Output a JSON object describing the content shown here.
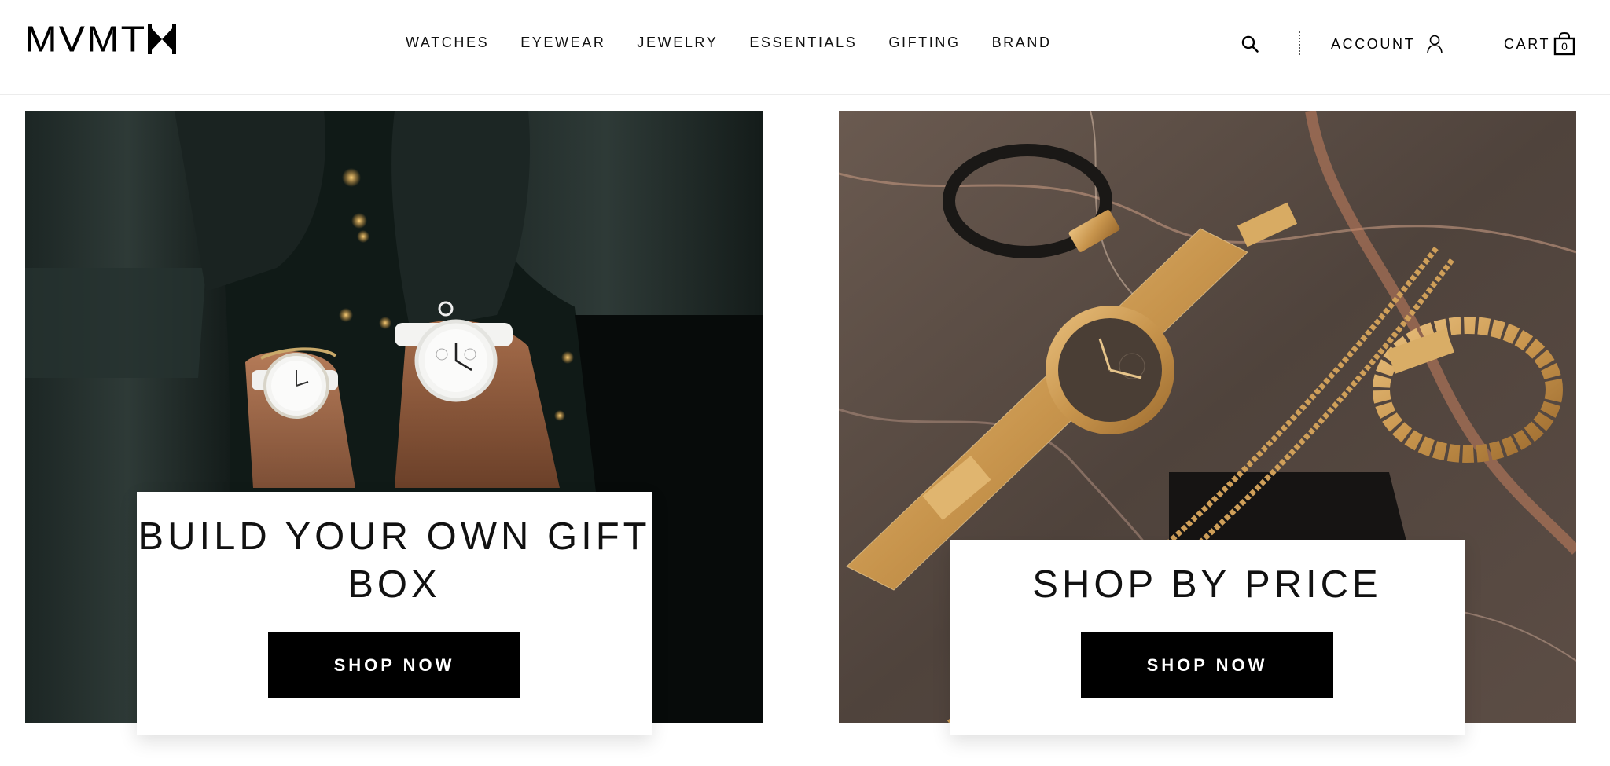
{
  "brand": {
    "logo_text": "MVMT"
  },
  "nav": {
    "items": [
      "WATCHES",
      "EYEWEAR",
      "JEWELRY",
      "ESSENTIALS",
      "GIFTING",
      "BRAND"
    ]
  },
  "utility": {
    "account_label": "ACCOUNT",
    "cart_label": "CART",
    "cart_count": "0"
  },
  "tiles": [
    {
      "title": "BUILD YOUR OWN GIFT BOX",
      "cta": "SHOP NOW",
      "image": "two wrists wearing white chronograph watches"
    },
    {
      "title": "SHOP BY PRICE",
      "cta": "SHOP NOW",
      "image": "gold mesh watch, chains and bracelets on marble"
    }
  ],
  "colors": {
    "text": "#000000",
    "button_bg": "#000000",
    "button_text": "#ffffff",
    "card_bg": "#ffffff"
  },
  "icons": [
    "search-icon",
    "user-icon",
    "shopping-bag-icon"
  ]
}
